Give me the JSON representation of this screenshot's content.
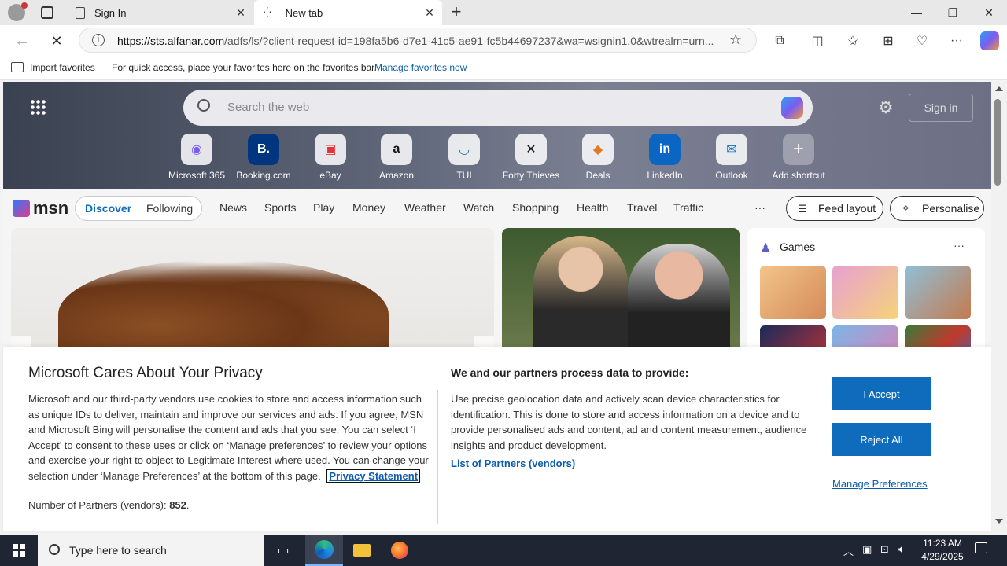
{
  "tabs": [
    {
      "label": "Sign In",
      "active": false
    },
    {
      "label": "New tab",
      "active": true
    }
  ],
  "address": {
    "url_host": "https://sts.alfanar.com",
    "url_rest": "/adfs/ls/?client-request-id=198fa5b6-d7e1-41c5-ae91-fc5b44697237&wa=wsignin1.0&wtrealm=urn..."
  },
  "favorites_bar": {
    "import_label": "Import favorites",
    "hint": "For quick access, place your favorites here on the favorites bar.",
    "manage_link": "Manage favorites now"
  },
  "msn": {
    "search_placeholder": "Search the web",
    "sign_in": "Sign in",
    "shortcuts": [
      "Microsoft 365",
      "Booking.com",
      "eBay",
      "Amazon",
      "TUI",
      "Forty Thieves",
      "Deals",
      "LinkedIn",
      "Outlook",
      "Add shortcut"
    ],
    "logo": "msn",
    "nav": {
      "discover": "Discover",
      "following": "Following",
      "items": [
        "News",
        "Sports",
        "Play",
        "Money",
        "Weather",
        "Watch",
        "Shopping",
        "Health",
        "Travel",
        "Traffic"
      ],
      "more": "···",
      "feed_layout": "Feed layout",
      "personalise": "Personalise"
    },
    "games_title": "Games"
  },
  "consent": {
    "title": "Microsoft Cares About Your Privacy",
    "body": "Microsoft and our third-party vendors use cookies to store and access information such as unique IDs to deliver, maintain and improve our services and ads. If you agree, MSN and Microsoft Bing will personalise the content and ads that you see. You can select ‘I Accept’ to consent to these uses or click on ‘Manage preferences’ to review your options and exercise your right to object to Legitimate Interest where used.  You can change your selection under ‘Manage Preferences’ at the bottom of this page.",
    "privacy_link": "Privacy Statement",
    "partners_label": "Number of Partners (vendors):",
    "partners_count": "852",
    "right_title": "We and our partners process data to provide:",
    "right_body": "Use precise geolocation data and actively scan device characteristics for identification. This is done to store and access information on a device and to provide personalised ads and content, ad and content measurement, audience insights and product development.",
    "vendors_link": "List of Partners (vendors)",
    "accept": "I Accept",
    "reject": "Reject All",
    "manage": "Manage Preferences"
  },
  "taskbar": {
    "search_placeholder": "Type here to search",
    "time": "11:23 AM",
    "date": "4/29/2025"
  },
  "colors": {
    "accent": "#0f6cbd",
    "link": "#0b5cad",
    "taskbar": "#1f2533"
  }
}
